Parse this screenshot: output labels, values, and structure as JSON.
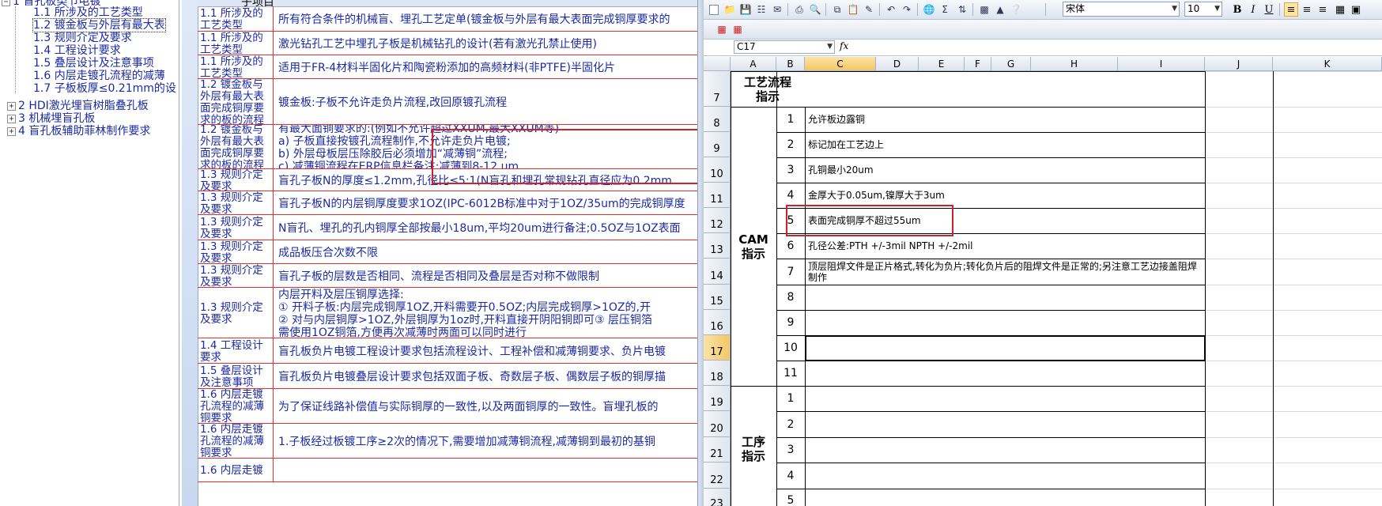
{
  "tree": {
    "root_label": "1 盲孔板类节电镀",
    "children": [
      "1.1 所涉及的工艺类型",
      "1.2 镀金板与外层有最大表",
      "1.3 规则介定及要求",
      "1.4 工程设计要求",
      "1.5 叠层设计及注意事项",
      "1.6 内层走镀孔流程的减薄",
      "1.7 子板板厚≤0.21mm的设"
    ],
    "selected_index": 1,
    "siblings": [
      "2 HDI激光埋盲树脂叠孔板",
      "3 机械埋盲孔板",
      "4 盲孔板辅助菲林制作要求"
    ]
  },
  "grid": {
    "header_label": "子项目",
    "rows": [
      {
        "item": "1.1 所涉及的工艺类型",
        "content": "所有符合条件的机械盲、埋孔工艺定单(镀金板与外层有最大表面完成铜厚要求的"
      },
      {
        "item": "1.1 所涉及的工艺类型",
        "content": "激光钻孔工艺中埋孔子板是机械钻孔的设计(若有激光孔禁止使用)"
      },
      {
        "item": "1.1 所涉及的工艺类型",
        "content": "适用于FR-4材料半固化片和陶瓷粉添加的高频材料(非PTFE)半固化片"
      },
      {
        "item": "1.2 镀金板与外层有最大表面完成铜厚要求的板的流程",
        "content": "镀金板:子板不允许走负片流程,改回原镀孔流程"
      },
      {
        "item": "1.2 镀金板与外层有最大表面完成铜厚要求的板的流程",
        "content": "有最大面铜要求的:(例如不允许超过XXUM,最大XXUM等)\na) 子板直接按镀孔流程制作,不允许走负片电镀;\nb) 外层母板层压除胶后必须增加“减薄铜”流程;\nc) 减薄铜流程在ERP信息栏备注:减薄到8-12 um"
      },
      {
        "item": "1.3 规则介定及要求",
        "content": "盲孔子板N的厚度≤1.2mm,孔径比≤5:1(N盲孔和埋孔常规钻孔直径应为0.2mm"
      },
      {
        "item": "1.3 规则介定及要求",
        "content": "盲孔子板N的内层铜厚度要求1OZ(IPC-6012B标准中对于1OZ/35um的完成铜厚度"
      },
      {
        "item": "1.3 规则介定及要求",
        "content": "N盲孔、埋孔的孔内铜厚全部按最小18um,平均20um进行备注;0.5OZ与1OZ表面"
      },
      {
        "item": "1.3 规则介定及要求",
        "content": "成品板压合次数不限"
      },
      {
        "item": "1.3 规则介定及要求",
        "content": "盲孔子板的层数是否相同、流程是否相同及叠层是否对称不做限制"
      },
      {
        "item": "1.3 规则介定及要求",
        "content": "内层开料及层压铜厚选择:\n① 开料子板:内层完成铜厚1OZ,开料需要开0.5OZ;内层完成铜厚>1OZ的,开\n② 对与内层铜厚>1OZ,外层铜厚为1oz时,开料直接开阴阳铜即可③ 层压铜箔\n需使用1OZ铜箔,方便再次减薄时两面可以同时进行"
      },
      {
        "item": "1.4 工程设计要求",
        "content": "盲孔板负片电镀工程设计要求包括流程设计、工程补偿和减薄铜要求、负片电镀"
      },
      {
        "item": "1.5 叠层设计及注意事项",
        "content": "盲孔板负片电镀叠层设计要求包括双面子板、奇数层子板、偶数层子板的铜厚描"
      },
      {
        "item": "1.6 内层走镀孔流程的减薄铜要求",
        "content": "为了保证线路补偿值与实际铜厚的一致性,以及两面铜厚的一致性。盲埋孔板的"
      },
      {
        "item": "1.6 内层走镀孔流程的减薄铜要求",
        "content": "1.子板经过板镀工序≥2次的情况下,需要增加减薄铜流程,减薄铜到最初的基铜"
      },
      {
        "item": "1.6 内层走镀",
        "content": ""
      }
    ]
  },
  "sheet": {
    "font_name": "宋体",
    "font_size": "10",
    "name_box": "C17",
    "fx": "fx",
    "columns": [
      "A",
      "B",
      "C",
      "D",
      "E",
      "F",
      "G",
      "H",
      "I",
      "J",
      "K"
    ],
    "selected_column": "C",
    "row_numbers": [
      "7",
      "8",
      "9",
      "10",
      "11",
      "12",
      "13",
      "14",
      "15",
      "16",
      "17",
      "18",
      "19",
      "20",
      "21",
      "22",
      "23"
    ],
    "selected_row": "17",
    "sections": {
      "process_flow": "工艺流程\n指示",
      "cam": "CAM\n指示",
      "procedure": "工序\n指示"
    },
    "cam_items": [
      {
        "no": "1",
        "text": "允许板边露铜"
      },
      {
        "no": "2",
        "text": "标记加在工艺边上"
      },
      {
        "no": "3",
        "text": "孔铜最小20um"
      },
      {
        "no": "4",
        "text": "金厚大于0.05um,镍厚大于3um"
      },
      {
        "no": "5",
        "text": "表面完成铜厚不超过55um"
      },
      {
        "no": "6",
        "text": "孔径公差:PTH +/-3mil NPTH +/-2mil"
      },
      {
        "no": "7",
        "text": "顶层阻焊文件是正片格式,转化为负片;转化负片后的阻焊文件是正常的;另注意工艺边接盖阻焊制作"
      },
      {
        "no": "8",
        "text": ""
      },
      {
        "no": "9",
        "text": ""
      },
      {
        "no": "10",
        "text": ""
      },
      {
        "no": "11",
        "text": ""
      }
    ],
    "procedure_items": [
      "1",
      "2",
      "3",
      "4",
      "5"
    ]
  },
  "colors": {
    "link_blue": "#1b2aa6",
    "grid_red": "#e03030",
    "highlight_red": "#d0202a",
    "selection_orange": "#f3c766"
  }
}
